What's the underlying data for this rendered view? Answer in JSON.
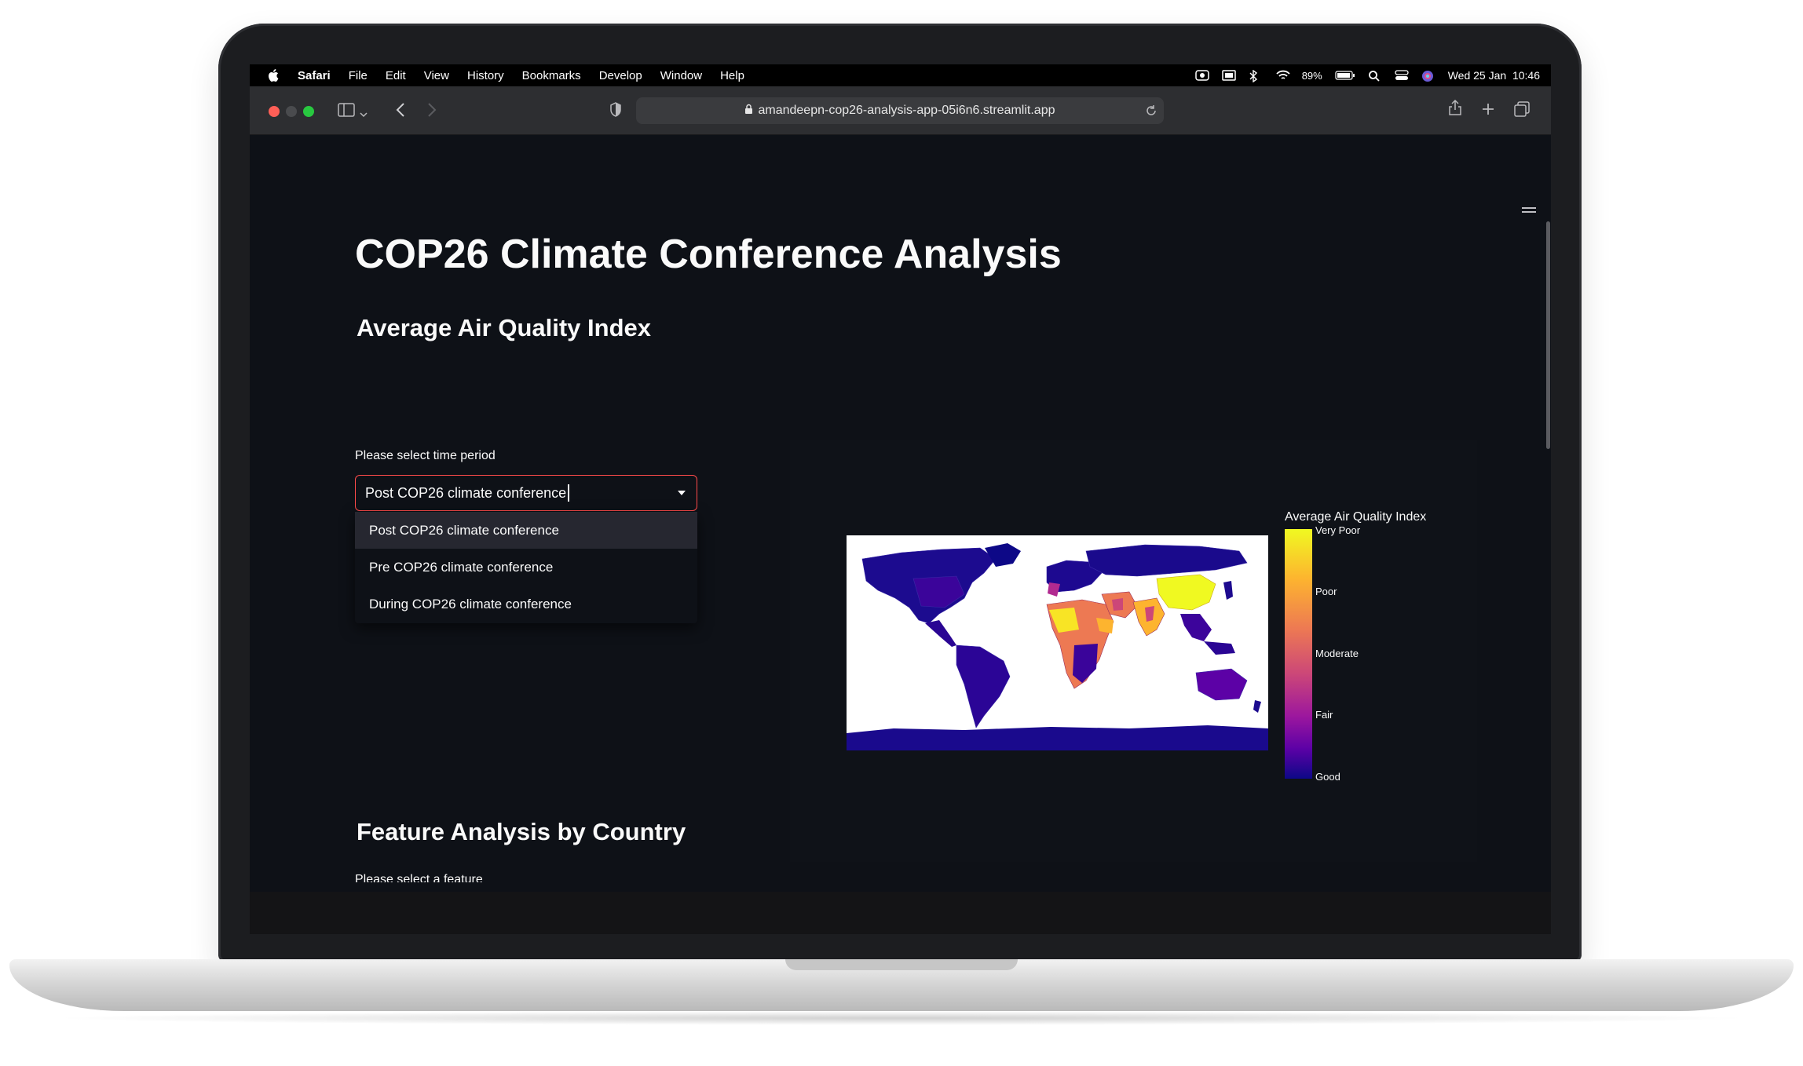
{
  "menubar": {
    "app": "Safari",
    "items": [
      "File",
      "Edit",
      "View",
      "History",
      "Bookmarks",
      "Develop",
      "Window",
      "Help"
    ],
    "battery": "89%",
    "datetime": "Wed 25 Jan  10:46"
  },
  "browser": {
    "url": "amandeepn-cop26-analysis-app-05i6n6.streamlit.app"
  },
  "page": {
    "title": "COP26 Climate Conference Analysis",
    "section1": {
      "heading": "Average Air Quality Index",
      "select_label": "Please select time period",
      "selected": "Post COP26 climate conference",
      "options": [
        "Post COP26 climate conference",
        "Pre COP26 climate conference",
        "During COP26 climate conference"
      ]
    },
    "chart": {
      "colorbar_title": "Average Air Quality Index",
      "ticks": [
        "Very Poor",
        "Poor",
        "Moderate",
        "Fair",
        "Good"
      ]
    },
    "section2": {
      "heading": "Feature Analysis by Country",
      "select_label": "Please select a feature"
    }
  },
  "colors": {
    "accent": "#ff4b4b",
    "background": "#0e1117",
    "crown_button": "#f2545b"
  },
  "icons": [
    "apple-icon",
    "wifi-icon",
    "bluetooth-icon",
    "battery-icon",
    "search-icon",
    "control-center-icon",
    "siri-icon",
    "lock-icon",
    "reload-icon",
    "share-icon",
    "new-tab-icon",
    "tabs-overview-icon",
    "sidebar-icon",
    "back-icon",
    "forward-icon",
    "shield-icon",
    "crown-icon",
    "hamburger-menu-icon"
  ]
}
